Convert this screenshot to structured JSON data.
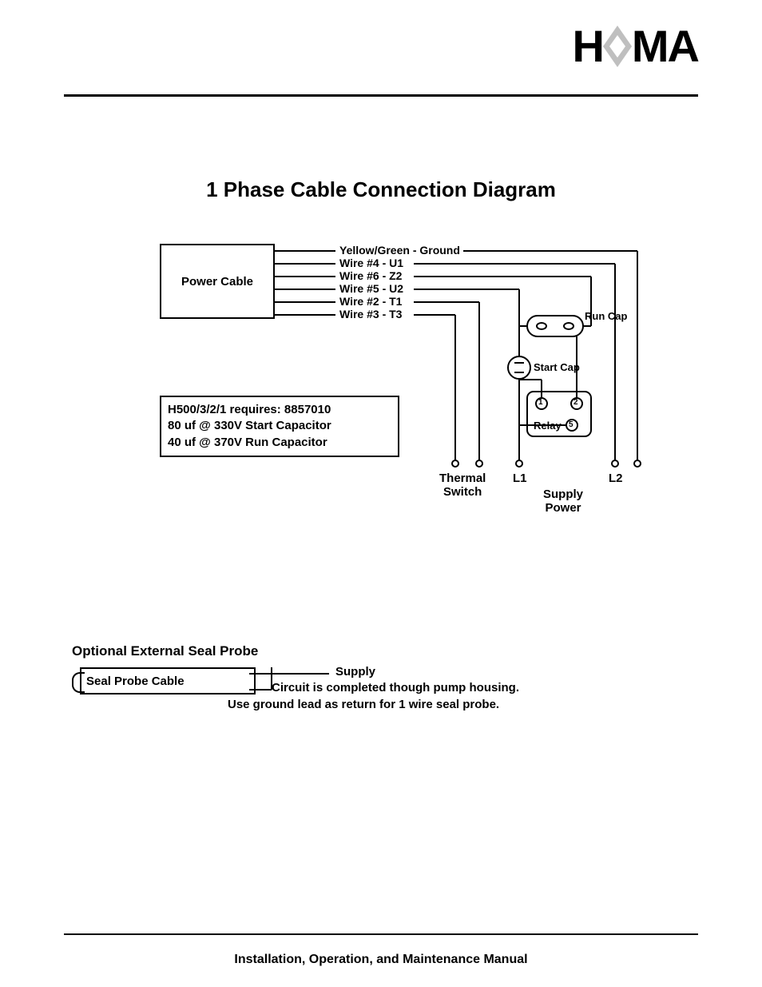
{
  "brand": "HOMA",
  "title": "1 Phase Cable Connection Diagram",
  "power_cable_label": "Power  Cable",
  "wires": [
    {
      "label": "Yellow/Green - Ground"
    },
    {
      "label": "Wire #4 - U1"
    },
    {
      "label": "Wire #6 - Z2"
    },
    {
      "label": "Wire #5 - U2"
    },
    {
      "label": "Wire #2 - T1"
    },
    {
      "label": "Wire #3 - T3"
    }
  ],
  "components": {
    "run_cap": "Run Cap",
    "start_cap": "Start Cap",
    "relay": "Relay",
    "relay_pins": {
      "one": "1",
      "two": "2",
      "five": "5"
    }
  },
  "terminals": {
    "thermal_switch": "Thermal\nSwitch",
    "l1": "L1",
    "l2": "L2",
    "supply_power": "Supply\nPower"
  },
  "spec": {
    "line1": "H500/3/2/1 requires: 8857010",
    "line2": "80 uf @ 330V Start Capacitor",
    "line3": "40 uf @ 370V Run Capacitor"
  },
  "probe": {
    "heading": "Optional External Seal Probe",
    "box_label": "Seal Probe Cable",
    "supply": "Supply",
    "note1": "Circuit is completed though pump housing.",
    "note2": "Use ground lead as return for 1 wire seal probe."
  },
  "footer": "Installation, Operation, and Maintenance Manual"
}
